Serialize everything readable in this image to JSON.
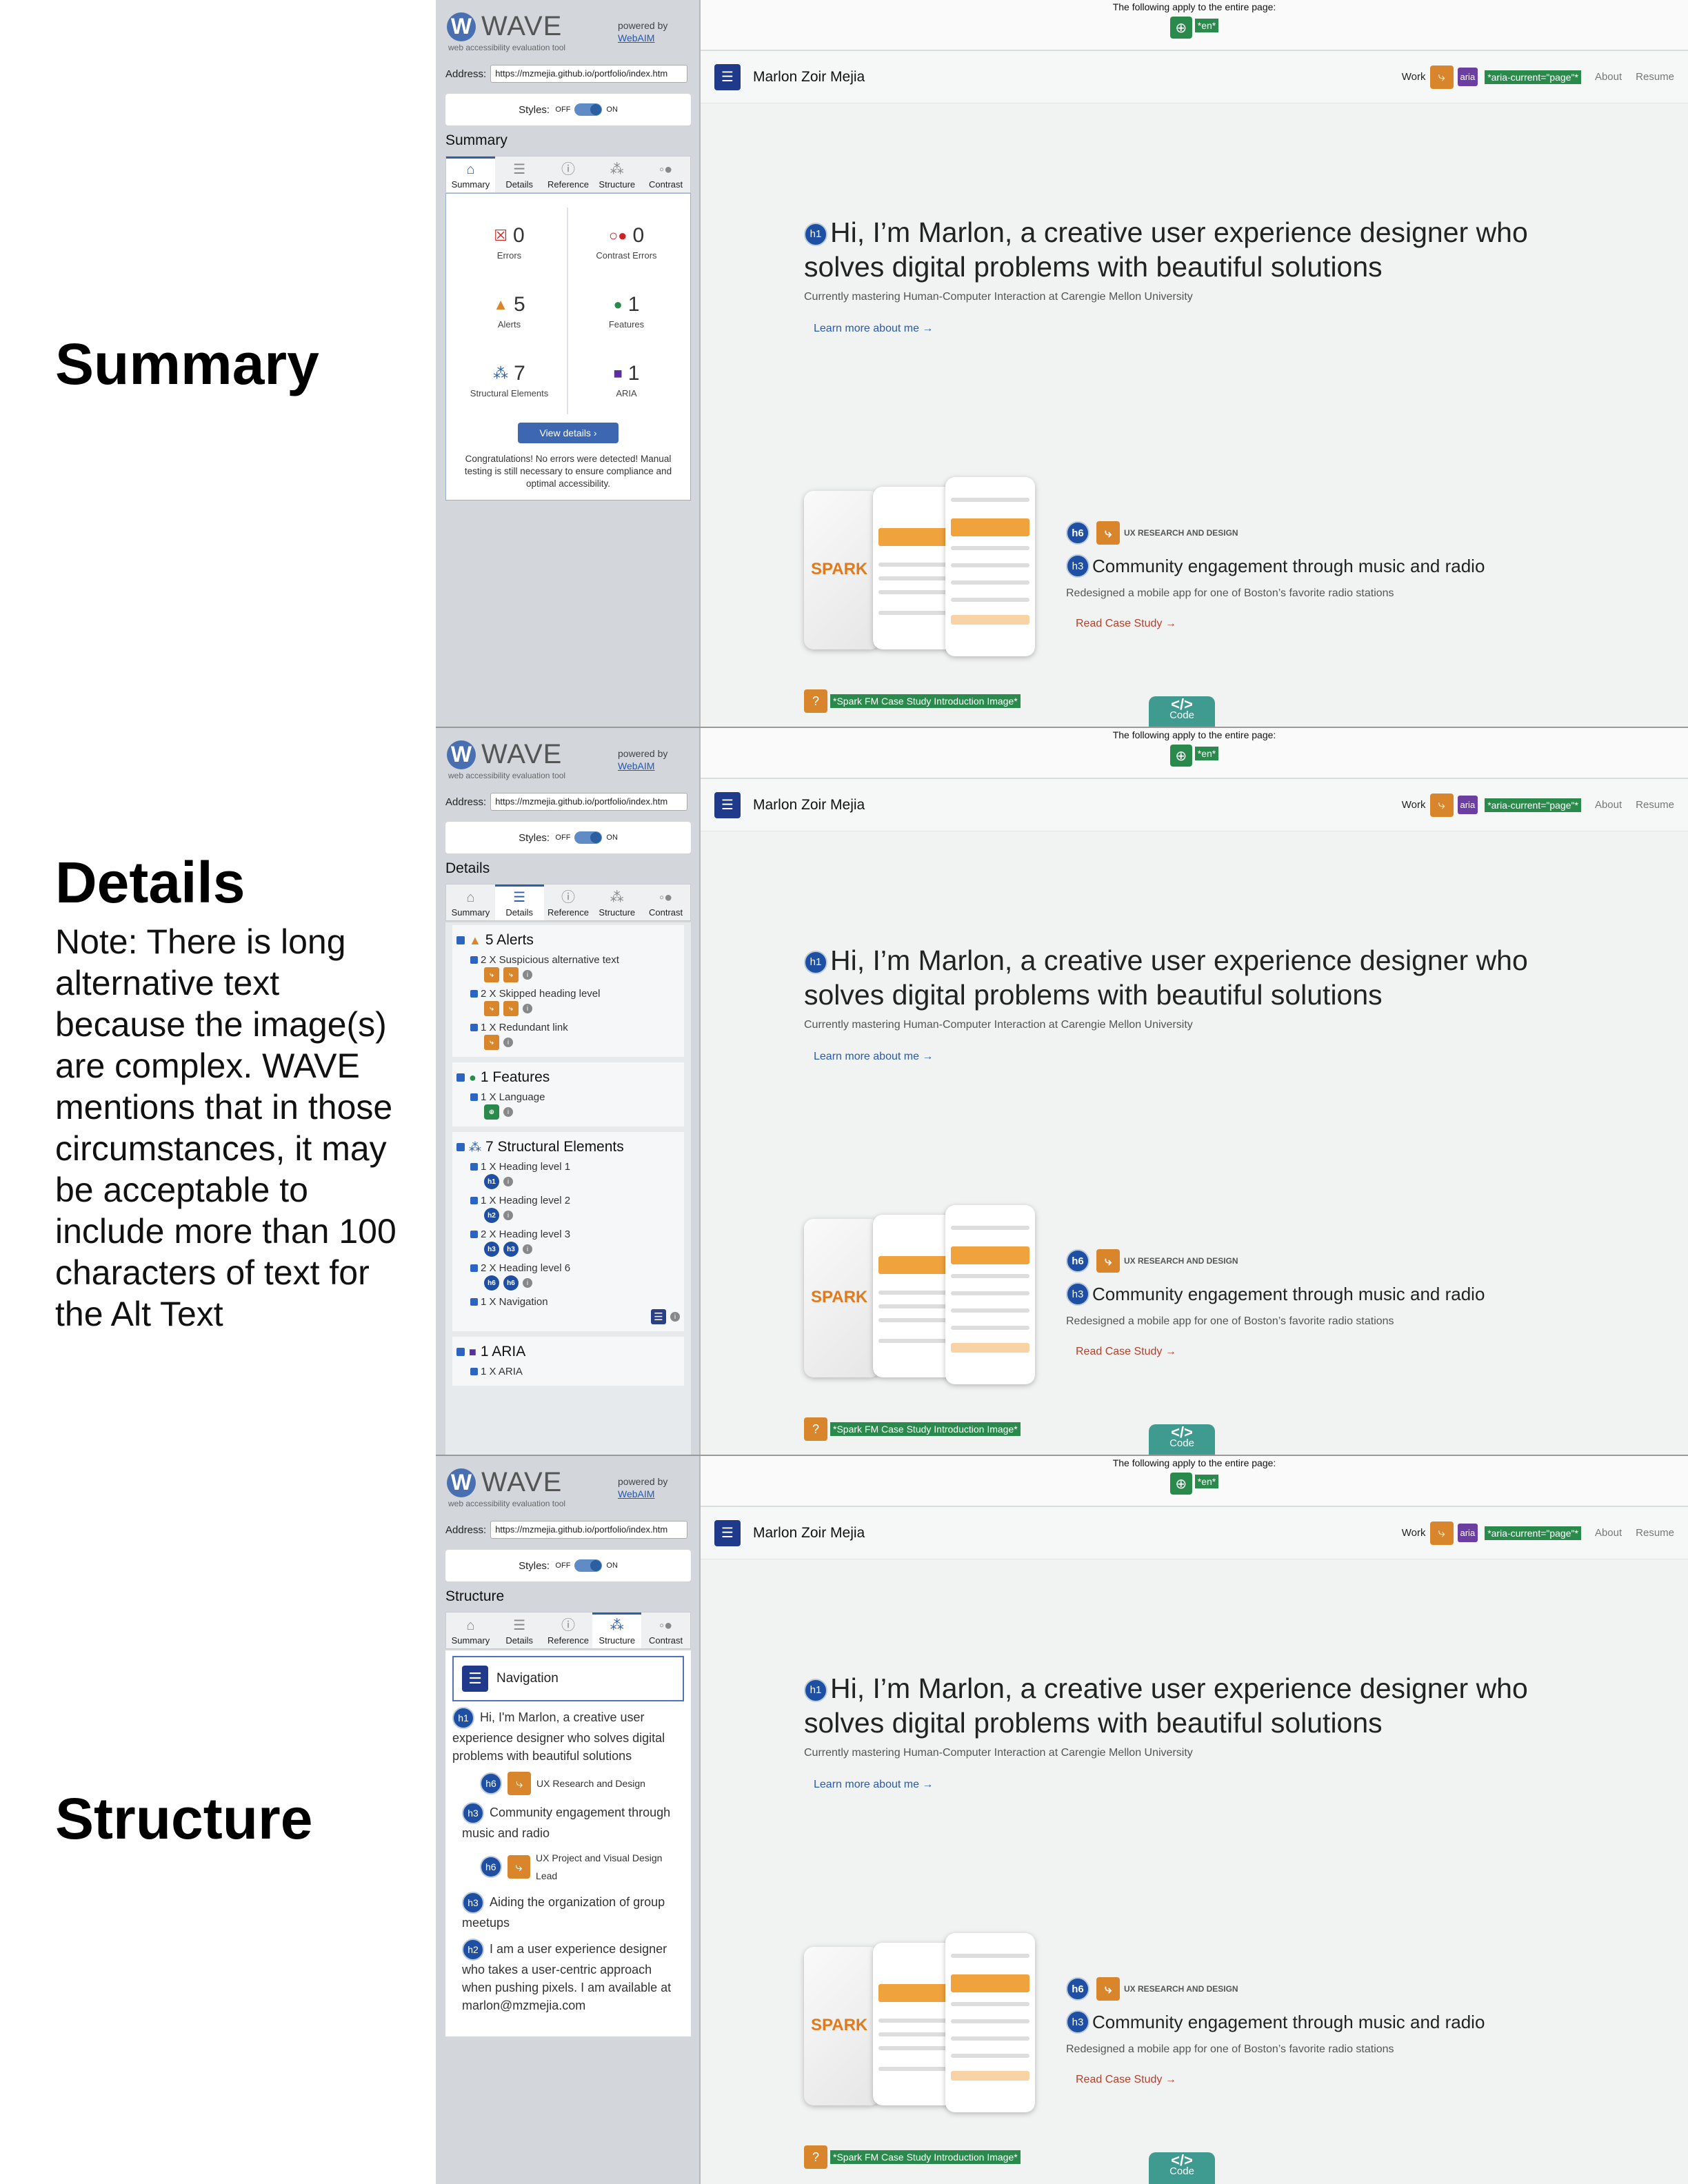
{
  "labels": {
    "summary": "Summary",
    "details": "Details",
    "structure": "Structure",
    "note": "Note: There is long alternative text because the image(s) are complex. WAVE mentions that in those circumstances, it may be acceptable to include more than 100 characters of text for the Alt Text"
  },
  "wave": {
    "name": "WAVE",
    "tagline": "web accessibility evaluation tool",
    "powered": "powered by",
    "webaim": "WebAIM",
    "address_label": "Address:",
    "address": "https://mzmejia.github.io/portfolio/index.htm",
    "styles_label": "Styles:",
    "off": "OFF",
    "on": "ON"
  },
  "tabs": [
    {
      "label": "Summary",
      "icon": "home-icon"
    },
    {
      "label": "Details",
      "icon": "list-icon"
    },
    {
      "label": "Reference",
      "icon": "info-icon"
    },
    {
      "label": "Structure",
      "icon": "structure-icon"
    },
    {
      "label": "Contrast",
      "icon": "contrast-icon"
    }
  ],
  "summary": {
    "title": "Summary",
    "errors": {
      "count": "0",
      "label": "Errors"
    },
    "contrast": {
      "count": "0",
      "label": "Contrast Errors"
    },
    "alerts": {
      "count": "5",
      "label": "Alerts"
    },
    "features": {
      "count": "1",
      "label": "Features"
    },
    "structural": {
      "count": "7",
      "label": "Structural Elements"
    },
    "aria": {
      "count": "1",
      "label": "ARIA"
    },
    "view_details": "View details ›",
    "congrats": "Congratulations! No errors were detected! Manual testing is still necessary to ensure compliance and optimal accessibility."
  },
  "details": {
    "title": "Details",
    "alerts_head": "5 Alerts",
    "alert_items": [
      "2 X Suspicious alternative text",
      "2 X Skipped heading level",
      "1 X Redundant link"
    ],
    "features_head": "1 Features",
    "feature_items": [
      "1 X Language"
    ],
    "structural_head": "7 Structural Elements",
    "structural_items": [
      "1 X Heading level 1",
      "1 X Heading level 2",
      "2 X Heading level 3",
      "2 X Heading level 6",
      "1 X Navigation"
    ],
    "aria_head": "1 ARIA",
    "aria_items": [
      "1 X ARIA"
    ]
  },
  "structure": {
    "title": "Structure",
    "navigation": "Navigation",
    "h1": "Hi, I'm Marlon, a creative user experience designer who solves digital problems with beautiful solutions",
    "h6a": "UX Research and Design",
    "h3a": "Community engagement through music and radio",
    "h6b": "UX Project and Visual Design Lead",
    "h3b": "Aiding the organization of group meetups",
    "h2": "I am a user experience designer who takes a user-centric approach when pushing pixels. I am available at marlon@mzmejia.com"
  },
  "site": {
    "apply": "The following apply to the entire page:",
    "lang_tag": "*en*",
    "name": "Marlon Zoir Mejia",
    "work": "Work",
    "aria": "aria",
    "aria_current": "*aria-current=\"page\"*",
    "about": "About",
    "resume": "Resume",
    "h1badge": "h1",
    "hero": "Hi, I’m Marlon, a creative user experience designer who solves digital problems with beautiful solutions",
    "sub": "Currently mastering Human-Computer Interaction at Carengie Mellon University",
    "learn": "Learn more about me →",
    "h6": "h6",
    "h3": "h3",
    "kicker": "UX RESEARCH AND DESIGN",
    "case_title": "Community engagement through music and radio",
    "case_desc": "Redesigned a mobile app for one of Boston’s favorite radio stations",
    "read": "Read Case Study →",
    "img_tag": "*Spark FM Case Study Introduction Image*",
    "brand": "SPARK",
    "code": "Code"
  }
}
